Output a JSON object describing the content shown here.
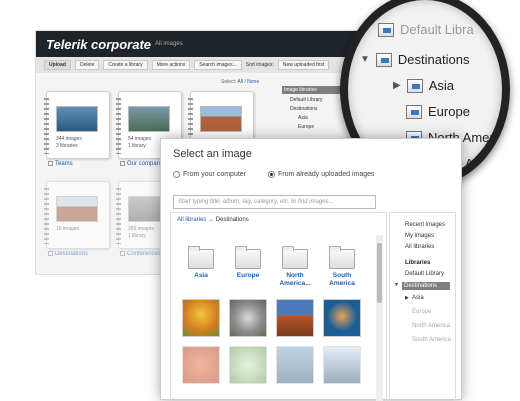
{
  "app": {
    "title": "Telerik corporate",
    "subtitle": "All images"
  },
  "toolbar": {
    "upload": "Upload",
    "delete": "Delete",
    "create_library": "Create a library",
    "more_actions": "More actions",
    "search_images": "Search images...",
    "sort_label": "Sort images:",
    "sort_value": "New uploaded first"
  },
  "select_bar": {
    "label": "Select:",
    "all": "All",
    "none": "None"
  },
  "albums": [
    {
      "name": "Teams",
      "count": "344 images",
      "sub": "3 libraries"
    },
    {
      "name": "Our company",
      "count": "54 images",
      "sub": "1 library"
    },
    {
      "name": "",
      "count": "",
      "sub": ""
    },
    {
      "name": "Destinations",
      "count": "15 images",
      "sub": ""
    },
    {
      "name": "Conferences",
      "count": "265 images",
      "sub": "1 library"
    }
  ],
  "bg_libraries": {
    "title": "Image libraries",
    "items": [
      "Default Library",
      "Destinations",
      "Asia",
      "Europe"
    ]
  },
  "dialog": {
    "title": "Select an image",
    "radio_computer": "From your computer",
    "radio_uploaded": "From already uploaded images",
    "search_placeholder": "Start typing title, album, tag, category, etc. to find images...",
    "breadcrumb_root": "All libraries",
    "breadcrumb_arrow": "→",
    "breadcrumb_current": "Destinations",
    "folders": [
      "Asia",
      "Europe",
      "North America...",
      "South America"
    ],
    "side": {
      "recent": "Recent images",
      "my": "My images",
      "all": "All libraries",
      "libraries_header": "Libraries",
      "default": "Default Library",
      "destinations": "Destinations",
      "asia": "Asia",
      "europe": "Europe",
      "north": "North America",
      "south": "South America"
    }
  },
  "magnifier": {
    "items": [
      "Default Libra",
      "Destinations",
      "Asia",
      "Europe",
      "North Americ",
      "South An"
    ]
  },
  "colors": {
    "link": "#1a5fb4",
    "header_bg": "#1f2429",
    "highlight": "#7f7f7f"
  }
}
